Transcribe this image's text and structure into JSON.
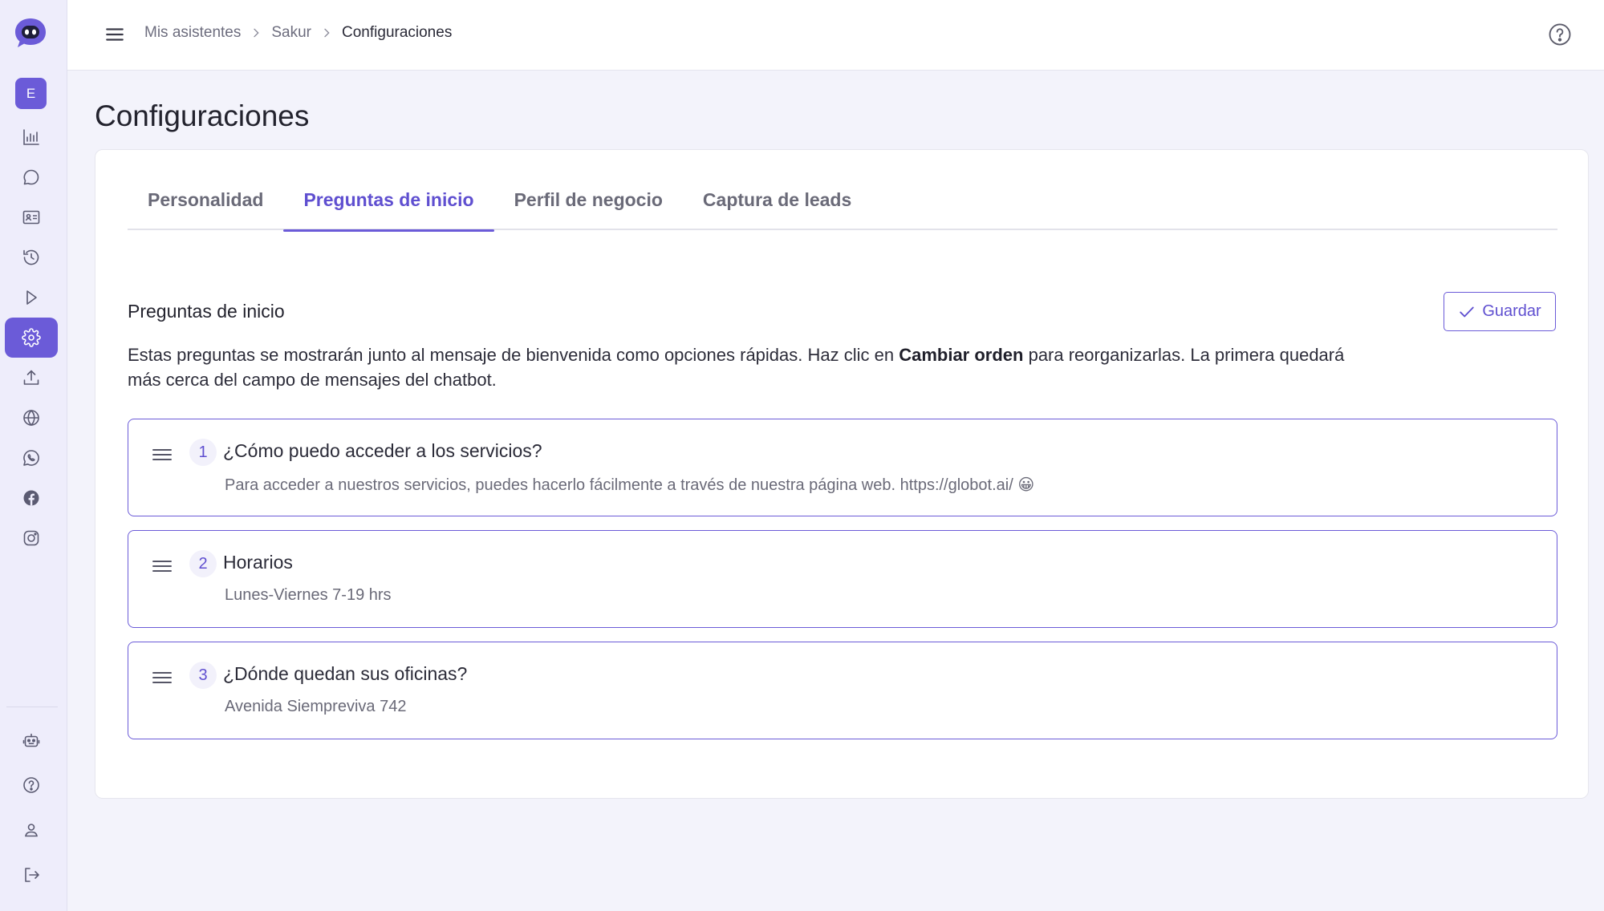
{
  "breadcrumb": [
    "Mis asistentes",
    "Sakur",
    "Configuraciones"
  ],
  "sidebar": {
    "workspace_initial": "E",
    "items": [
      {
        "icon": "bar-chart-icon"
      },
      {
        "icon": "chat-bubble-icon"
      },
      {
        "icon": "contact-card-icon"
      },
      {
        "icon": "history-icon"
      },
      {
        "icon": "play-icon"
      },
      {
        "icon": "gear-icon",
        "active": true
      },
      {
        "icon": "upload-icon"
      },
      {
        "icon": "globe-icon"
      },
      {
        "icon": "whatsapp-icon"
      },
      {
        "icon": "facebook-icon"
      },
      {
        "icon": "instagram-icon"
      }
    ],
    "bottom_items": [
      {
        "icon": "robot-icon"
      },
      {
        "icon": "help-circle-icon"
      },
      {
        "icon": "user-icon"
      },
      {
        "icon": "logout-icon"
      }
    ]
  },
  "page": {
    "title": "Configuraciones"
  },
  "tabs": [
    {
      "label": "Personalidad",
      "active": false
    },
    {
      "label": "Preguntas de inicio",
      "active": true
    },
    {
      "label": "Perfil de negocio",
      "active": false
    },
    {
      "label": "Captura de leads",
      "active": false
    }
  ],
  "section": {
    "title": "Preguntas de inicio",
    "save_label": "Guardar",
    "desc_before": "Estas preguntas se mostrarán junto al mensaje de bienvenida como opciones rápidas. Haz clic en ",
    "desc_bold": "Cambiar orden",
    "desc_after": " para reorganizarlas. La primera quedará más cerca del campo de mensajes del chatbot."
  },
  "questions": [
    {
      "number": "1",
      "title": "¿Cómo puedo acceder a los servicios?",
      "answer": "Para acceder a nuestros servicios, puedes hacerlo fácilmente a través de nuestra página web. https://globot.ai/ 😀"
    },
    {
      "number": "2",
      "title": "Horarios",
      "answer": "Lunes-Viernes 7-19 hrs"
    },
    {
      "number": "3",
      "title": "¿Dónde quedan sus oficinas?",
      "answer": "Avenida Siempreviva 742"
    }
  ],
  "colors": {
    "accent": "#6b5bd8",
    "sidebar_bg": "#eeedfb",
    "page_bg": "#f3f3fb"
  }
}
